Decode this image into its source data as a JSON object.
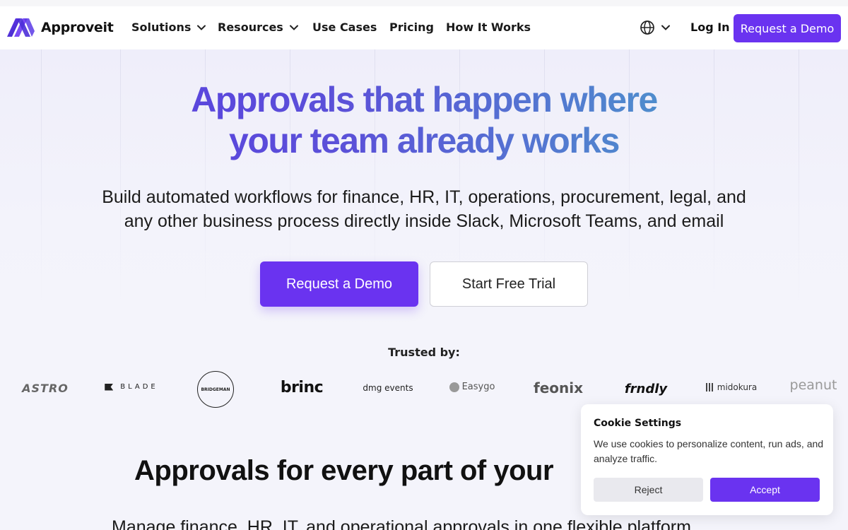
{
  "nav": {
    "brand": "Approveit",
    "items": [
      {
        "label": "Solutions",
        "has_dropdown": true
      },
      {
        "label": "Resources",
        "has_dropdown": true
      },
      {
        "label": "Use Cases",
        "has_dropdown": false
      },
      {
        "label": "Pricing",
        "has_dropdown": false
      },
      {
        "label": "How It Works",
        "has_dropdown": false
      }
    ],
    "language_icon": "globe-icon",
    "login_label": "Log In",
    "demo_label": "Request a Demo"
  },
  "hero": {
    "headline_line1": "Approvals that happen where",
    "headline_line2": "your team already works",
    "subhead_line1": "Build automated workflows for finance, HR, IT, operations, procurement, legal, and",
    "subhead_line2": "any other business process directly inside Slack, Microsoft Teams, and email",
    "primary_cta": "Request a Demo",
    "secondary_cta": "Start Free Trial"
  },
  "trusted": {
    "label": "Trusted by:",
    "logos": [
      "ASTRO",
      "BLADE",
      "BRIDGEMAN",
      "brinc",
      "dmg events",
      "Easygo",
      "feonix",
      "frndly",
      "midokura",
      "peanut"
    ]
  },
  "section": {
    "title": "Approvals for every part of your",
    "subtitle": "Manage finance, HR, IT, and operational approvals in one flexible platform"
  },
  "cookie": {
    "title": "Cookie Settings",
    "text": "We use cookies to personalize content, run ads, and analyze traffic.",
    "reject_label": "Reject",
    "accept_label": "Accept"
  },
  "colors": {
    "accent": "#6a33f0",
    "headline_gradient_start": "#5a3de0",
    "headline_gradient_end": "#4aa4c8",
    "page_bg": "#f4f4fb"
  }
}
